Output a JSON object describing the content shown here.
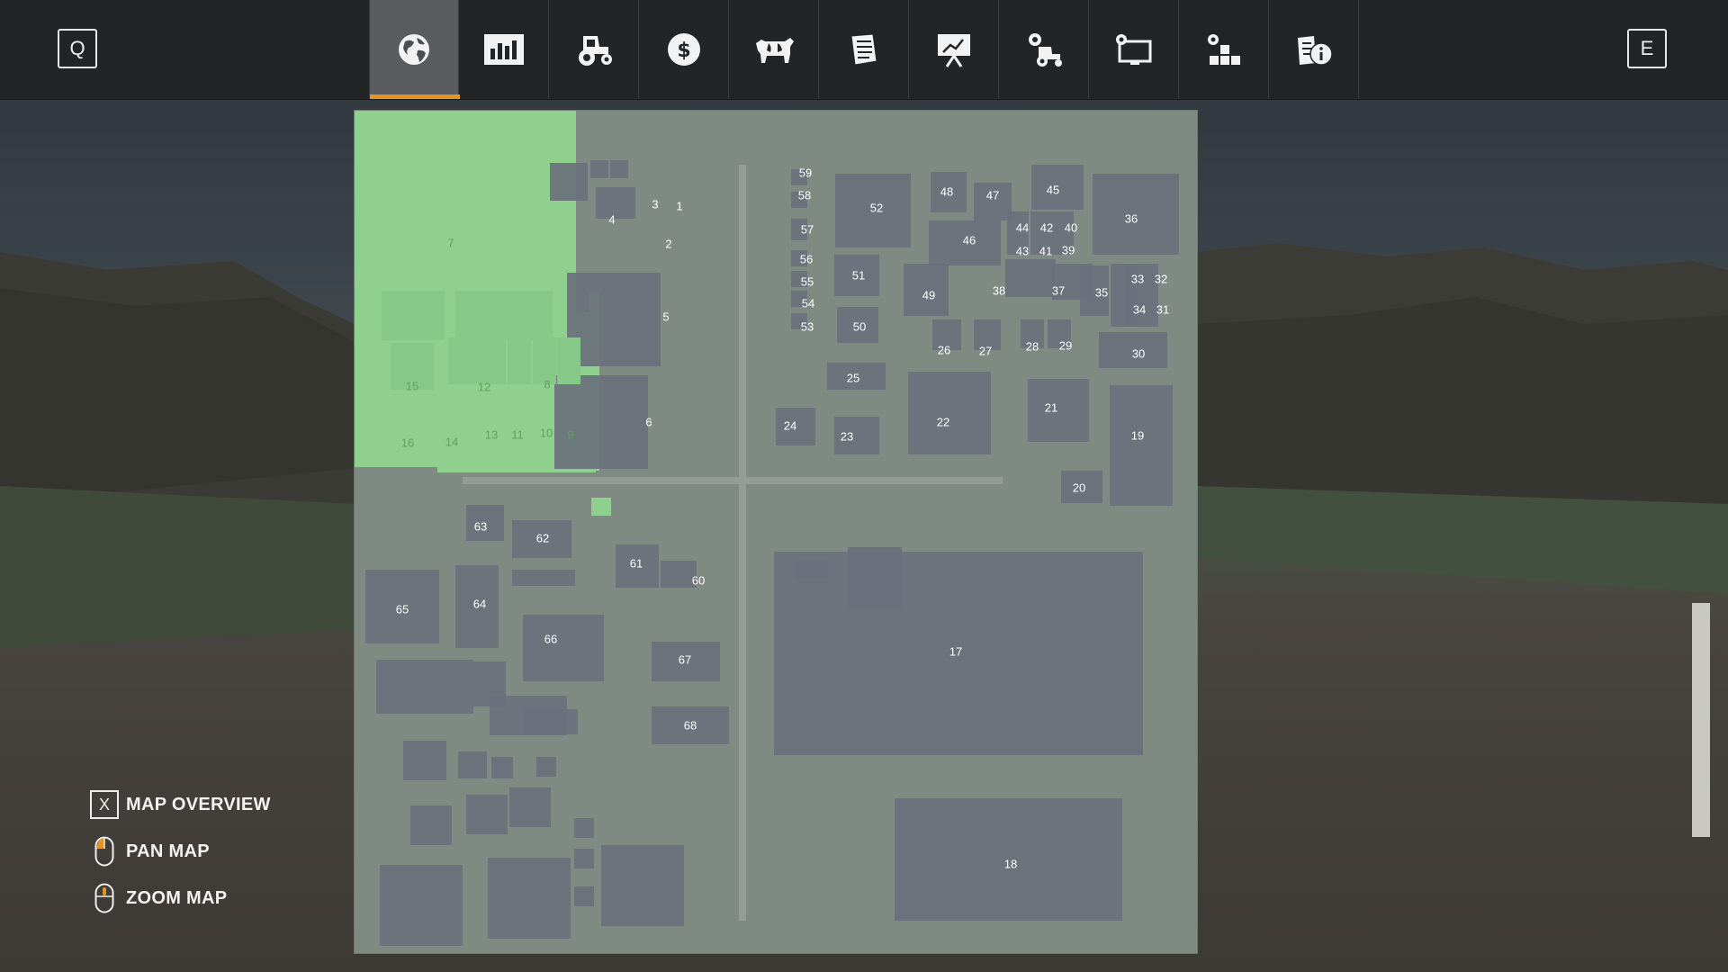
{
  "topbar": {
    "prev_key": "Q",
    "next_key": "E",
    "tabs": [
      {
        "id": "map",
        "icon": "globe-icon",
        "active": true
      },
      {
        "id": "stats",
        "icon": "bar-chart-icon",
        "active": false
      },
      {
        "id": "vehicles",
        "icon": "tractor-icon",
        "active": false
      },
      {
        "id": "finances",
        "icon": "dollar-icon",
        "active": false
      },
      {
        "id": "animals",
        "icon": "cow-icon",
        "active": false
      },
      {
        "id": "contracts",
        "icon": "contracts-icon",
        "active": false
      },
      {
        "id": "tour",
        "icon": "presentation-icon",
        "active": false
      },
      {
        "id": "production",
        "icon": "gear-tractor-icon",
        "active": false
      },
      {
        "id": "settings",
        "icon": "monitor-gear-icon",
        "active": false
      },
      {
        "id": "controls",
        "icon": "blocks-icon",
        "active": false
      },
      {
        "id": "help",
        "icon": "info-icon",
        "active": false
      }
    ],
    "accent_color": "#e29425"
  },
  "map": {
    "owned_color": "#8fd08f",
    "field_labels": [
      "1",
      "2",
      "3",
      "4",
      "5",
      "6",
      "7",
      "8",
      "9",
      "10",
      "11",
      "12",
      "13",
      "14",
      "15",
      "16",
      "17",
      "18",
      "19",
      "20",
      "21",
      "22",
      "23",
      "24",
      "25",
      "26",
      "27",
      "28",
      "29",
      "30",
      "31",
      "32",
      "33",
      "34",
      "35",
      "36",
      "37",
      "38",
      "39",
      "40",
      "41",
      "42",
      "43",
      "44",
      "45",
      "46",
      "47",
      "48",
      "49",
      "50",
      "51",
      "52",
      "53",
      "54",
      "55",
      "56",
      "57",
      "58",
      "59",
      "60",
      "61",
      "62",
      "63",
      "64",
      "65",
      "66",
      "67",
      "68"
    ]
  },
  "legend": {
    "items": [
      {
        "key": "X",
        "label": "MAP OVERVIEW"
      },
      {
        "key": "mouse-pan",
        "label": "PAN MAP"
      },
      {
        "key": "mouse-zoom",
        "label": "ZOOM MAP"
      }
    ]
  }
}
